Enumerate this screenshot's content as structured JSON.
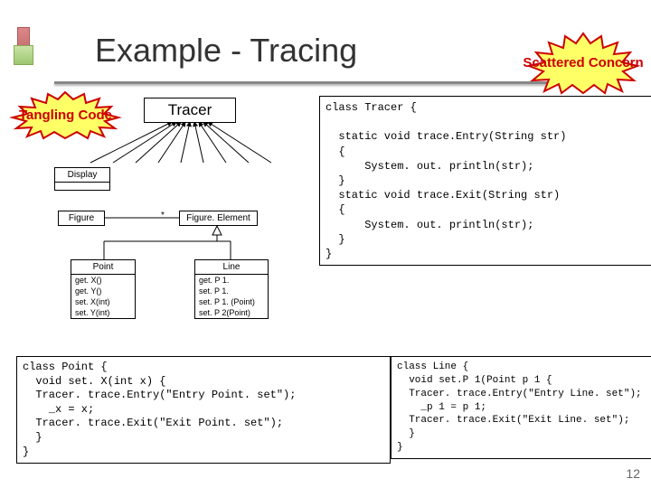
{
  "title": "Example - Tracing",
  "burst_left": "Tangling Code",
  "burst_right": "Scattered Concern",
  "tracer_label": "Tracer",
  "uml": {
    "display": "Display",
    "figure": "Figure",
    "figure_element": "Figure. Element",
    "point": "Point",
    "line": "Line",
    "star": "*",
    "point_methods": [
      "get. X()",
      "get. Y()",
      "set. X(int)",
      "set. Y(int)"
    ],
    "line_methods": [
      "get. P 1.",
      "set. P 1.",
      "set. P 1. (Point)",
      "set. P 2(Point)"
    ]
  },
  "code": {
    "tracer": "class Tracer {\n\n  static void trace.Entry(String str)\n  {\n      System. out. println(str);\n  }\n  static void trace.Exit(String str)\n  {\n      System. out. println(str);\n  }\n}",
    "point": "class Point {\n  void set. X(int x) {\n  Tracer. trace.Entry(\"Entry Point. set\");\n    _x = x;\n  Tracer. trace.Exit(\"Exit Point. set\");\n  }\n}",
    "line": "class Line {\n  void set.P 1(Point p 1 {\n  Tracer. trace.Entry(\"Entry Line. set\");\n    _p 1 = p 1;\n  Tracer. trace.Exit(\"Exit Line. set\");\n  }\n}"
  },
  "slide_number": "12"
}
